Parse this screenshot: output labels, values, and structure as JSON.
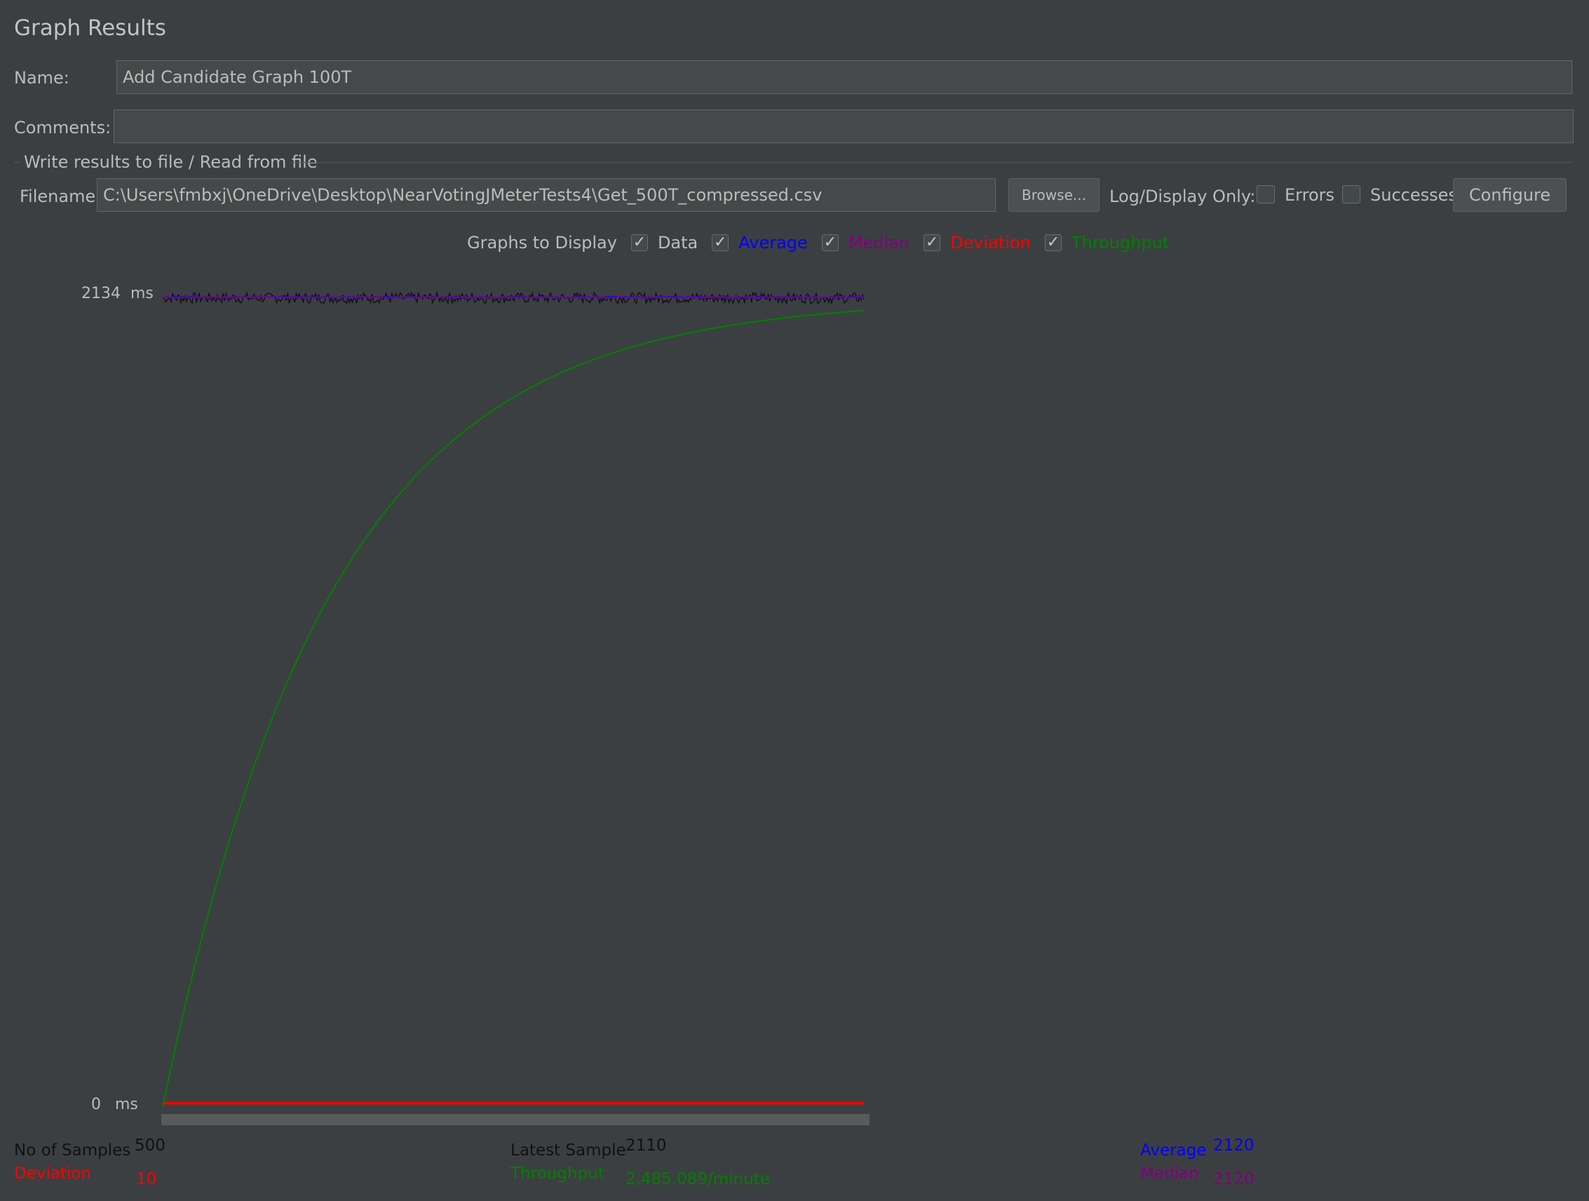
{
  "panel": {
    "title": "Graph Results"
  },
  "name_row": {
    "label": "Name:",
    "value": "Add Candidate Graph 100T"
  },
  "comments_row": {
    "label": "Comments:",
    "value": ""
  },
  "file_section": {
    "legend": "Write results to file / Read from file",
    "filename_label": "Filename",
    "filename_value": "C:\\Users\\fmbxj\\OneDrive\\Desktop\\NearVotingJMeterTests4\\Get_500T_compressed.csv",
    "browse_label": "Browse...",
    "log_display_label": "Log/Display Only:",
    "errors_label": "Errors",
    "errors_checked": false,
    "successes_label": "Successes",
    "successes_checked": false,
    "configure_label": "Configure"
  },
  "graphs_to_display": {
    "label": "Graphs to Display",
    "options": [
      {
        "label": "Data",
        "checked": true,
        "color": "#111111"
      },
      {
        "label": "Average",
        "checked": true,
        "color": "#0000ff"
      },
      {
        "label": "Median",
        "checked": true,
        "color": "#800080"
      },
      {
        "label": "Deviation",
        "checked": true,
        "color": "#ff0000"
      },
      {
        "label": "Throughput",
        "checked": true,
        "color": "#008000"
      }
    ]
  },
  "check_glyph": "✓",
  "axis": {
    "max_label": "2134",
    "min_label": "0",
    "unit": "ms"
  },
  "chart_data": {
    "type": "line",
    "ylim": [
      0,
      2134
    ],
    "y_unit": "ms",
    "x_samples": 500,
    "series": [
      {
        "name": "Data",
        "color": "#111111",
        "level": 2118,
        "noise": 14
      },
      {
        "name": "Average",
        "color": "#0000ff",
        "level": 2120,
        "noise": 2
      },
      {
        "name": "Median",
        "color": "#800080",
        "level": 2120,
        "noise": 1
      },
      {
        "name": "Deviation",
        "color": "#ff0000",
        "level": 10,
        "noise": 0
      },
      {
        "name": "Throughput",
        "color": "#008000",
        "end_value": 2085,
        "curve": "saturating"
      }
    ]
  },
  "stats": {
    "samples_label": "No of Samples",
    "samples_value": "500",
    "latest_label": "Latest Sample",
    "latest_value": "2110",
    "average_label": "Average",
    "average_value": "2120",
    "deviation_label": "Deviation",
    "deviation_value": "10",
    "throughput_label": "Throughput",
    "throughput_value": "2,485.089/minute",
    "median_label": "Median",
    "median_value": "2120"
  }
}
